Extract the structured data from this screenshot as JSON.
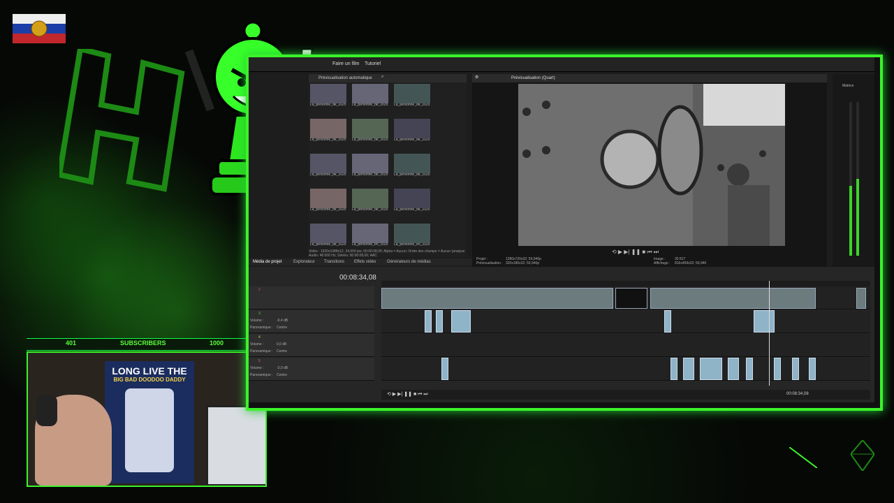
{
  "overlay": {
    "subscriber_count": "401",
    "subscriber_label": "SUBSCRIBERS",
    "subscriber_goal": "1000",
    "poster_line1": "LONG LIVE THE",
    "poster_line2": "BIG BAD DOODOO DADDY"
  },
  "editor": {
    "menu": {
      "make_movie": "Faire un film",
      "tutorial": "Tutoriel"
    },
    "media_panel": {
      "preview_mode": "Prévisualisation automatique",
      "clips": [
        {
          "name": "La_personne_de_202510 192251.mp4"
        },
        {
          "name": "La_personne_de_202510 192284.mp4"
        },
        {
          "name": "La_personne_de_202510 192309.mp4"
        },
        {
          "name": "La_personne_de_202510 192331.mp4"
        },
        {
          "name": "La_personne_de_202510 192354.mp4"
        },
        {
          "name": "La_personne_de_202510 200040.mp4"
        },
        {
          "name": "La_personne_de_202510 200043.mp4"
        },
        {
          "name": "La_personne_de_202510 200049.mp4"
        },
        {
          "name": "La_personne_de_202510 200140.mp4"
        },
        {
          "name": "La_personne_de_202510 200217.mp4"
        },
        {
          "name": "La_personne_de_202510 200225.mp4"
        },
        {
          "name": "La_personne_de_202510 200238 (1).mp4"
        },
        {
          "name": "La_personne_de_202510 200315.mp4"
        },
        {
          "name": "La_personne_en_202510 200044.mp4"
        },
        {
          "name": "La_personne_en_202510 200248.mp4"
        }
      ],
      "info_line1": "Vidéo : 1920x1088x12, 24,000 ips; 00:00:08,00; Alpha = Aucun; Ordre des champs = Aucun (analyse",
      "info_line2": "Audio: 48 000 Hz; Stéréo; 00:00:08,00; AAC"
    },
    "tabs": [
      "Média de projet",
      "Explorateur",
      "Transitions",
      "Effets vidéo",
      "Générateurs de médias"
    ],
    "preview": {
      "label": "Prévisualisation (Quart)",
      "project_label": "Projet :",
      "project_value": "1280x720x32; 59,940p",
      "preview_label": "Prévisualisation :",
      "preview_value": "320x180x32; 59,940p",
      "image_label": "Image :",
      "image_value": "30 817",
      "display_label": "Affichage :",
      "display_value": "816x459x32; 59,940"
    },
    "meter": {
      "label": "Matrice"
    },
    "timeline": {
      "timecode": "00:08:34,08",
      "tracks": [
        {
          "number": "2",
          "type": "video"
        },
        {
          "number": "3",
          "volume_label": "Volume :",
          "volume": "-9,4 dB",
          "pan_label": "Panoramique :",
          "pan": "Centre"
        },
        {
          "number": "4",
          "volume_label": "Volume :",
          "volume": "0,0 dB",
          "pan_label": "Panoramique :",
          "pan": "Centre"
        },
        {
          "number": "5",
          "volume_label": "Volume :",
          "volume": "-3,0 dB",
          "pan_label": "Panoramique :",
          "pan": "Centre"
        }
      ],
      "status_timecode": "00:08:34,08"
    }
  },
  "colors": {
    "accent": "#3cf22a",
    "frame_bg": "#1d1d1d"
  }
}
